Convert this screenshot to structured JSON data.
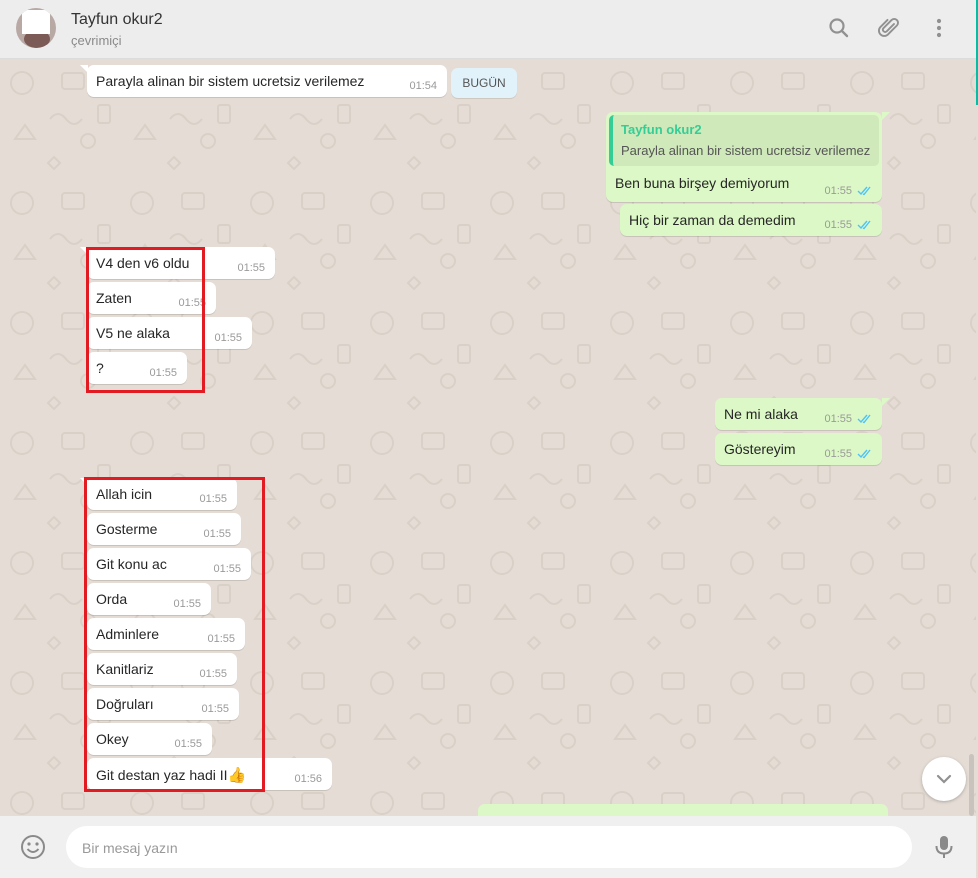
{
  "header": {
    "name": "Tayfun okur2",
    "status": "çevrimiçi"
  },
  "chat": {
    "date_chip": "BUGÜN",
    "messages": [
      {
        "dir": "in",
        "text": "Parayla alinan bir sistem ucretsiz verilemez",
        "time": "01:54"
      },
      {
        "dir": "out",
        "quote_author": "Tayfun okur2",
        "quote_text": "Parayla alinan bir sistem ucretsiz verilemez",
        "text": "Ben buna birşey demiyorum",
        "time": "01:55"
      },
      {
        "dir": "out",
        "text": "Hiç bir zaman da demedim",
        "time": "01:55"
      },
      {
        "dir": "in",
        "text": "V4 den v6 oldu",
        "time": "01:55"
      },
      {
        "dir": "in",
        "text": "Zaten",
        "time": "01:55"
      },
      {
        "dir": "in",
        "text": "V5 ne alaka",
        "time": "01:55"
      },
      {
        "dir": "in",
        "text": "?",
        "time": "01:55"
      },
      {
        "dir": "out",
        "text": "Ne mi alaka",
        "time": "01:55"
      },
      {
        "dir": "out",
        "text": "Göstereyim",
        "time": "01:55"
      },
      {
        "dir": "in",
        "text": "Allah icin",
        "time": "01:55"
      },
      {
        "dir": "in",
        "text": "Gosterme",
        "time": "01:55"
      },
      {
        "dir": "in",
        "text": "Git konu ac",
        "time": "01:55"
      },
      {
        "dir": "in",
        "text": "Orda",
        "time": "01:55"
      },
      {
        "dir": "in",
        "text": "Adminlere",
        "time": "01:55"
      },
      {
        "dir": "in",
        "text": "Kanitlariz",
        "time": "01:55"
      },
      {
        "dir": "in",
        "text": "Doğruları",
        "time": "01:55"
      },
      {
        "dir": "in",
        "text": "Okey",
        "time": "01:55"
      },
      {
        "dir": "in",
        "text": "Git destan yaz hadi II",
        "emoji": "👍",
        "time": "01:56"
      }
    ]
  },
  "composer": {
    "placeholder": "Bir mesaj yazın"
  },
  "icons": {
    "header": [
      "search-icon",
      "attach-icon",
      "menu-icon"
    ],
    "footer": [
      "emoji-icon",
      "mic-icon"
    ],
    "scroll": "chevron-down-icon"
  },
  "colors": {
    "incoming": "#ffffff",
    "outgoing": "#dcf8c6",
    "chat_bg": "#e5ddd5",
    "read_ticks": "#4fc3f7",
    "highlight": "#e21a22"
  }
}
